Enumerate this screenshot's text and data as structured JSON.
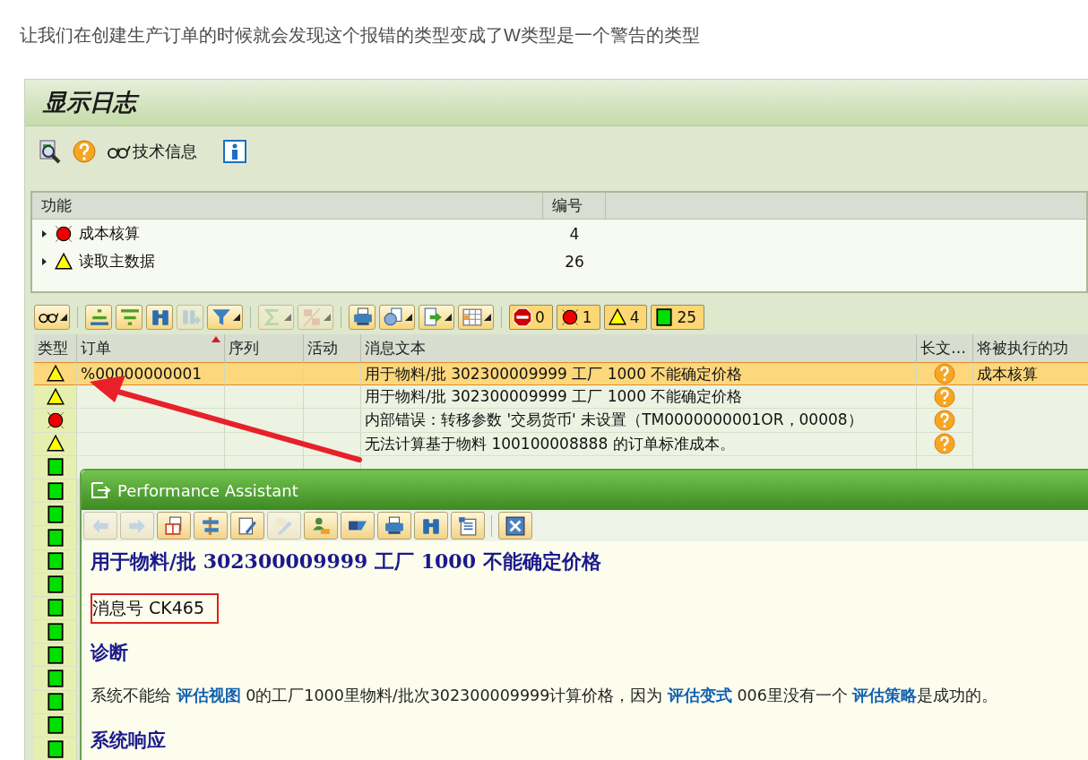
{
  "intro": "让我们在创建生产订单的时候就会发现这个报错的类型变成了W类型是一个警告的类型",
  "window": {
    "title": "显示日志",
    "tech_info_label": "技术信息"
  },
  "tree": {
    "columns": [
      "功能",
      "编号"
    ],
    "rows": [
      {
        "kind": "error",
        "label": "成本核算",
        "count": "4",
        "expanded": false
      },
      {
        "kind": "warning",
        "label": "读取主数据",
        "count": "26",
        "expanded": false
      }
    ]
  },
  "alv": {
    "tool_buttons": [
      {
        "kind": "glasses",
        "dropdown": true,
        "disabled": false
      },
      {
        "kind": "sort-up",
        "dropdown": false,
        "disabled": false
      },
      {
        "kind": "sort-down",
        "dropdown": false,
        "disabled": false
      },
      {
        "kind": "binoculars",
        "dropdown": false,
        "disabled": false
      },
      {
        "kind": "binoculars-plus",
        "dropdown": false,
        "disabled": true
      },
      {
        "kind": "funnel",
        "dropdown": true,
        "disabled": false
      },
      {
        "kind": "sigma",
        "dropdown": true,
        "disabled": true
      },
      {
        "kind": "subtotal",
        "dropdown": true,
        "disabled": true
      },
      {
        "kind": "printer",
        "dropdown": false,
        "disabled": false
      },
      {
        "kind": "view",
        "dropdown": true,
        "disabled": false
      },
      {
        "kind": "export",
        "dropdown": true,
        "disabled": false
      },
      {
        "kind": "layout",
        "dropdown": true,
        "disabled": false
      }
    ],
    "counters": [
      {
        "kind": "stop",
        "count": "0"
      },
      {
        "kind": "error",
        "count": "1"
      },
      {
        "kind": "warning",
        "count": "4"
      },
      {
        "kind": "success",
        "count": "25"
      }
    ],
    "columns": [
      {
        "label": "类型",
        "sorted": false
      },
      {
        "label": "订单",
        "sorted": true
      },
      {
        "label": "序列",
        "sorted": false
      },
      {
        "label": "活动",
        "sorted": false
      },
      {
        "label": "消息文本",
        "sorted": false
      },
      {
        "label": "长文…",
        "sorted": false
      },
      {
        "label": "将被执行的功",
        "sorted": false
      }
    ],
    "rows": [
      {
        "kind": "warning",
        "selected": true,
        "order": "%00000000001",
        "message": "用于物料/批 302300009999 工厂 1000 不能确定价格",
        "long_text": true,
        "function": "成本核算"
      },
      {
        "kind": "warning",
        "selected": false,
        "message": "用于物料/批 302300009999 工厂 1000 不能确定价格",
        "long_text": true
      },
      {
        "kind": "error",
        "selected": false,
        "message": "内部错误：转移参数 '交易货币' 未设置（TM0000000001OR，00008）",
        "long_text": true
      },
      {
        "kind": "warning",
        "selected": false,
        "message": "无法计算基于物料 100100008888 的订单标准成本。",
        "long_text": true
      },
      {
        "kind": "success",
        "selected": false,
        "long_text": false
      },
      {
        "kind": "success",
        "selected": false
      },
      {
        "kind": "success",
        "selected": false
      },
      {
        "kind": "success",
        "selected": false
      },
      {
        "kind": "success",
        "selected": false
      },
      {
        "kind": "success",
        "selected": false
      },
      {
        "kind": "success",
        "selected": false
      },
      {
        "kind": "success",
        "selected": false
      },
      {
        "kind": "success",
        "selected": false
      },
      {
        "kind": "success",
        "selected": false
      },
      {
        "kind": "success",
        "selected": false
      },
      {
        "kind": "success",
        "selected": false
      },
      {
        "kind": "success",
        "selected": false
      }
    ]
  },
  "popup": {
    "title": "Performance Assistant",
    "tool_buttons": [
      {
        "kind": "back",
        "disabled": true
      },
      {
        "kind": "forward",
        "disabled": true
      },
      {
        "kind": "book",
        "disabled": false
      },
      {
        "kind": "tools",
        "disabled": false
      },
      {
        "kind": "edit",
        "disabled": false
      },
      {
        "kind": "pencil",
        "disabled": true
      },
      {
        "kind": "user-key",
        "disabled": false
      },
      {
        "kind": "flag",
        "disabled": false
      },
      {
        "kind": "printer",
        "disabled": false
      },
      {
        "kind": "binoculars",
        "disabled": false
      },
      {
        "kind": "list",
        "disabled": false
      },
      {
        "kind": "close",
        "disabled": false
      }
    ],
    "heading": "用于物料/批 302300009999 工厂 1000 不能确定价格",
    "message_number": "消息号 CK465",
    "sections": [
      {
        "kind": "heading",
        "text": "诊断"
      },
      {
        "kind": "paragraph",
        "text": "系统不能给 **评估视图** 0的工厂1000里物料/批次302300009999计算价格，因为 **评估变式** 006里没有一个 **评估策略**是成功的。"
      },
      {
        "kind": "heading",
        "text": "系统响应"
      }
    ]
  }
}
